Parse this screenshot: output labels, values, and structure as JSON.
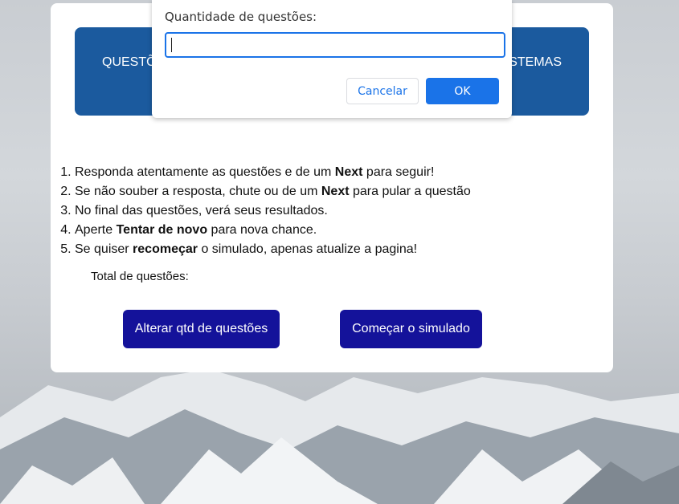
{
  "banner": {
    "left_text": "QUESTÕ",
    "right_text": "STEMAS"
  },
  "instructions": {
    "items": [
      {
        "pre": "Responda atentamente as questões e de um ",
        "bold": "Next",
        "post": " para seguir!"
      },
      {
        "pre": "Se não souber a resposta, chute ou de um ",
        "bold": "Next",
        "post": " para pular a questão"
      },
      {
        "pre": "No final das questões, verá seus resultados.",
        "bold": "",
        "post": ""
      },
      {
        "pre": "Aperte ",
        "bold": "Tentar de novo",
        "post": " para nova chance."
      },
      {
        "pre": "Se quiser ",
        "bold": "recomeçar",
        "post": " o simulado, apenas atualize a pagina!"
      }
    ]
  },
  "total": {
    "label": "Total de questões:"
  },
  "buttons": {
    "alter_label": "Alterar qtd de questões",
    "start_label": "Começar o simulado"
  },
  "dialog": {
    "label": "Quantidade de questões:",
    "input_value": "",
    "cancel_label": "Cancelar",
    "ok_label": "OK"
  },
  "colors": {
    "banner": "#1b5a9e",
    "button": "#14129a",
    "dialog_accent": "#1a73e8"
  }
}
